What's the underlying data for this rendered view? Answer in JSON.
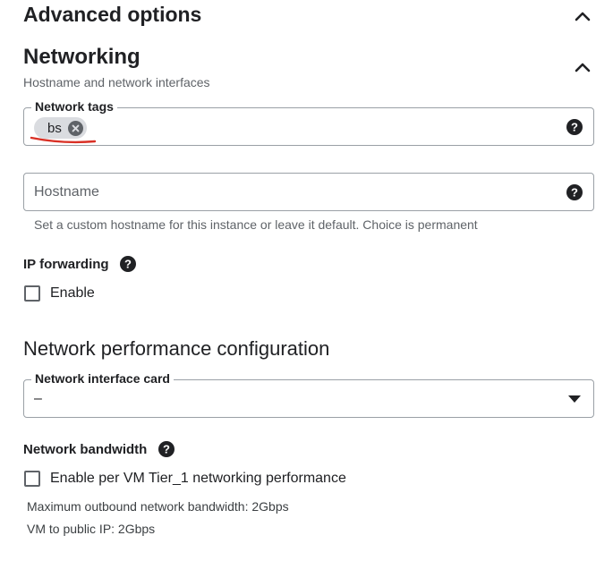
{
  "advanced": {
    "title": "Advanced options"
  },
  "networking": {
    "title": "Networking",
    "subtitle": "Hostname and network interfaces",
    "tags": {
      "label": "Network tags",
      "chips": [
        "bs"
      ]
    },
    "hostname": {
      "placeholder": "Hostname",
      "hint": "Set a custom hostname for this instance or leave it default. Choice is permanent"
    },
    "ip_forwarding": {
      "label": "IP forwarding",
      "checkbox_label": "Enable",
      "checked": false
    }
  },
  "performance": {
    "title": "Network performance configuration",
    "nic": {
      "label": "Network interface card",
      "value": "–"
    },
    "bandwidth": {
      "label": "Network bandwidth",
      "checkbox_label": "Enable per VM Tier_1 networking performance",
      "checked": false,
      "max_outbound": "Maximum outbound network bandwidth: 2Gbps",
      "vm_to_public": "VM to public IP: 2Gbps"
    }
  },
  "colors": {
    "text": "#202124",
    "muted": "#5f6368",
    "border": "#9aa0a6",
    "chip": "#dadce0",
    "annotation": "#d93025"
  }
}
